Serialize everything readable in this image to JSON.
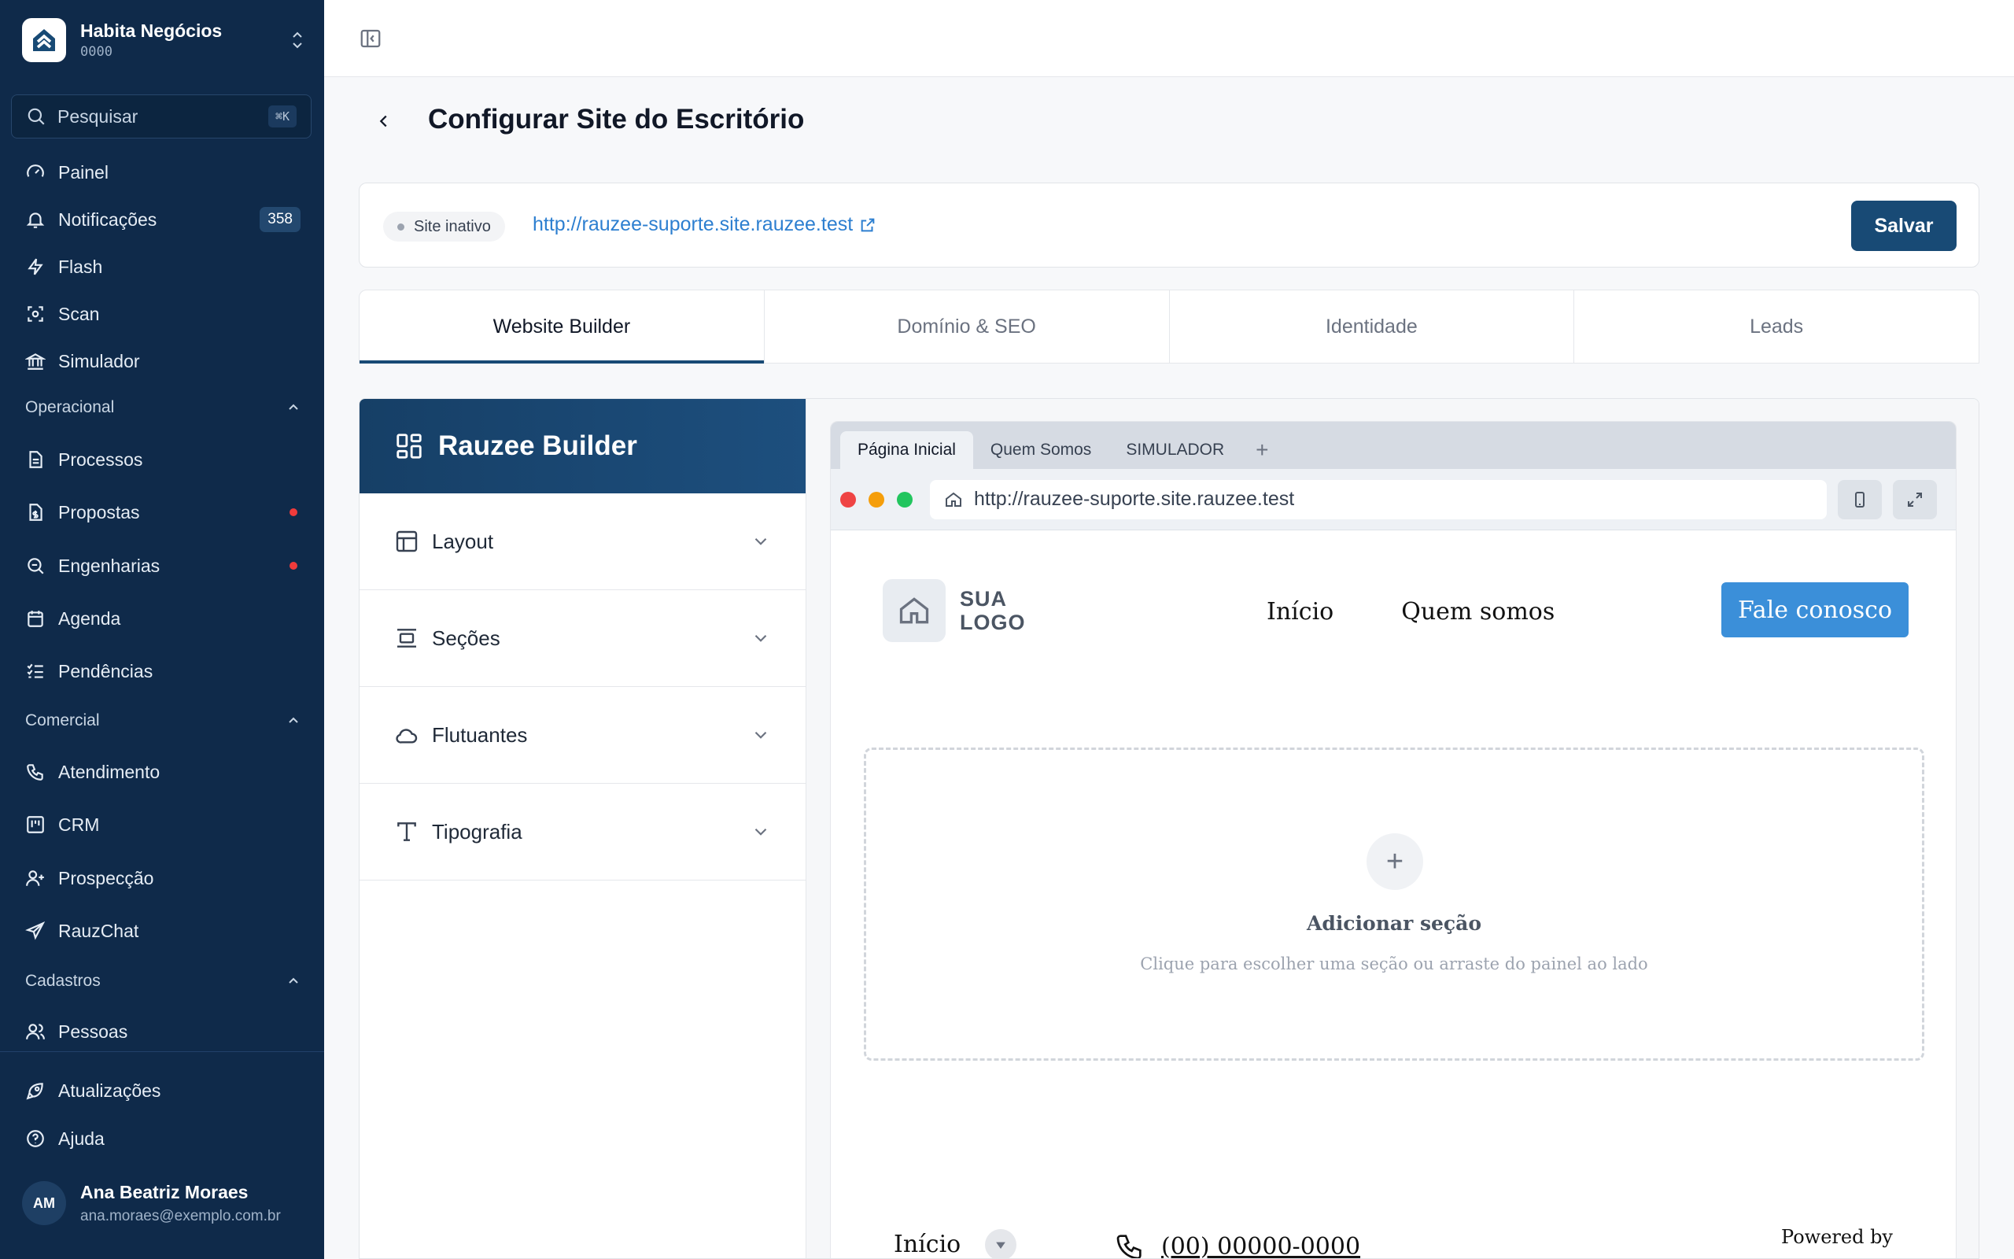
{
  "org": {
    "name": "Habita Negócios",
    "code": "0000"
  },
  "search": {
    "placeholder": "Pesquisar",
    "shortcut": "⌘K"
  },
  "nav": {
    "painel": "Painel",
    "notificacoes": "Notificações",
    "notificacoes_count": "358",
    "flash": "Flash",
    "scan": "Scan",
    "simulador": "Simulador",
    "group_operacional": "Operacional",
    "processos": "Processos",
    "propostas": "Propostas",
    "engenharias": "Engenharias",
    "agenda": "Agenda",
    "pendencias": "Pendências",
    "group_comercial": "Comercial",
    "atendimento": "Atendimento",
    "crm": "CRM",
    "prospeccao": "Prospecção",
    "rauzchat": "RauzChat",
    "group_cadastros": "Cadastros",
    "pessoas": "Pessoas",
    "atualizacoes": "Atualizações",
    "ajuda": "Ajuda"
  },
  "user": {
    "initials": "AM",
    "name": "Ana Beatriz Moraes",
    "email": "ana.moraes@exemplo.com.br"
  },
  "page": {
    "title": "Configurar Site do Escritório"
  },
  "site_bar": {
    "status": "Site inativo",
    "url": "http://rauzee-suporte.site.rauzee.test",
    "save": "Salvar"
  },
  "tabs": [
    "Website Builder",
    "Domínio & SEO",
    "Identidade",
    "Leads"
  ],
  "builder": {
    "title": "Rauzee Builder",
    "sections": [
      "Layout",
      "Seções",
      "Flutuantes",
      "Tipografia"
    ]
  },
  "browser": {
    "tabs": [
      "Página Inicial",
      "Quem Somos",
      "SIMULADOR"
    ],
    "add_tab": "+",
    "address": "http://rauzee-suporte.site.rauzee.test"
  },
  "site": {
    "logo_line1": "SUA",
    "logo_line2": "LOGO",
    "nav": [
      "Início",
      "Quem somos"
    ],
    "cta": "Fale conosco",
    "add_plus": "+",
    "add_title": "Adicionar seção",
    "add_sub": "Clique para escolher uma seção ou arraste do painel ao lado",
    "footer_inicio": "Início",
    "footer_phone": "(00) 00000-0000",
    "powered": "Powered by"
  },
  "colors": {
    "sidebar": "#0f2a4a",
    "accent": "#184a75",
    "link": "#2d7fd0",
    "cta": "#3b8fd9",
    "alert_dot": "#ef3b3b"
  }
}
